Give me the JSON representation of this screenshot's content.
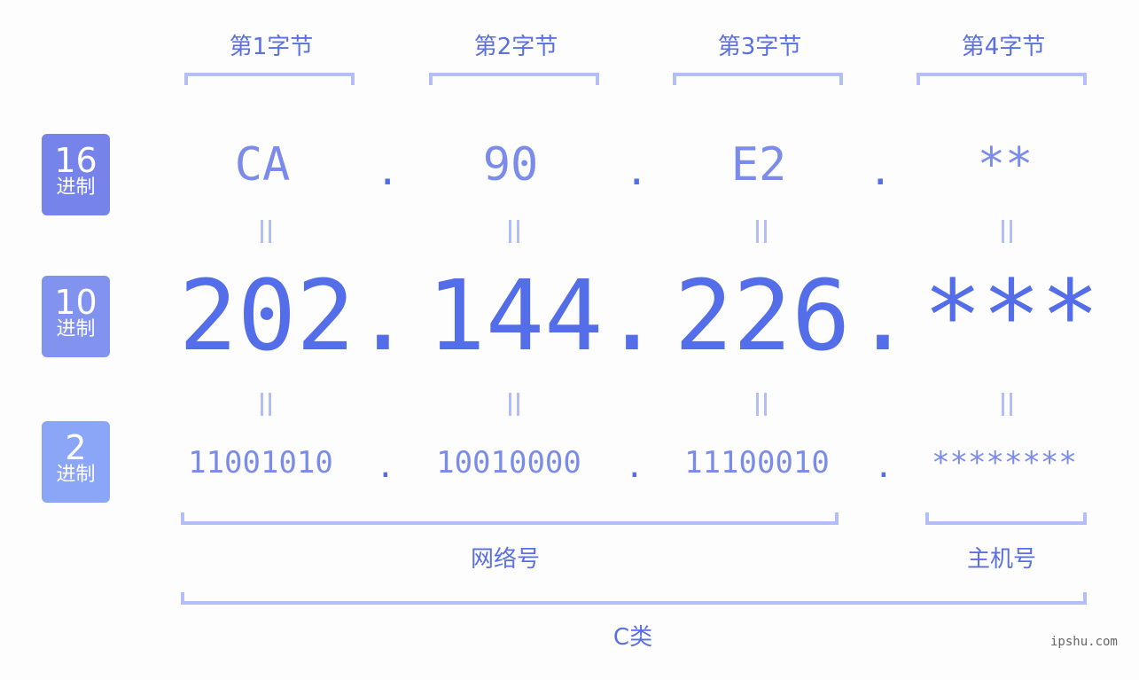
{
  "bytes": [
    "第1字节",
    "第2字节",
    "第3字节",
    "第4字节"
  ],
  "badges": [
    {
      "num": "16",
      "unit": "进制",
      "color": "#7583ea"
    },
    {
      "num": "10",
      "unit": "进制",
      "color": "#8192ef"
    },
    {
      "num": "2",
      "unit": "进制",
      "color": "#8ca6f7"
    }
  ],
  "hex": [
    "CA",
    "90",
    "E2",
    "**"
  ],
  "decimal": [
    "202",
    "144",
    "226",
    "***"
  ],
  "binary": [
    "11001010",
    "10010000",
    "11100010",
    "********"
  ],
  "separator": ".",
  "labels": {
    "network": "网络号",
    "host": "主机号",
    "class": "C类"
  },
  "watermark": "ipshu.com"
}
